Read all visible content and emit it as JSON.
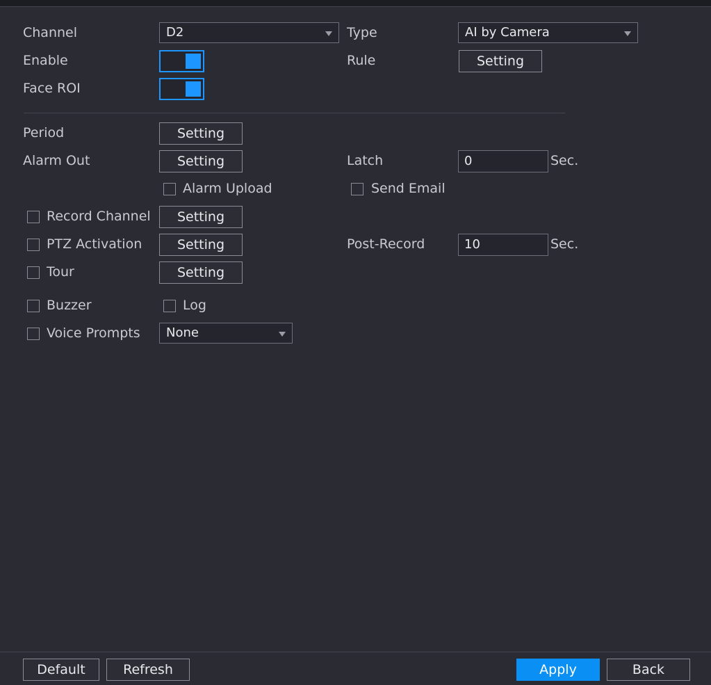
{
  "channel": {
    "label": "Channel",
    "value": "D2"
  },
  "type": {
    "label": "Type",
    "value": "AI by Camera"
  },
  "enable": {
    "label": "Enable",
    "on": true
  },
  "rule": {
    "label": "Rule",
    "button": "Setting"
  },
  "face_roi": {
    "label": "Face ROI",
    "on": true
  },
  "period": {
    "label": "Period",
    "button": "Setting"
  },
  "alarm_out": {
    "label": "Alarm Out",
    "button": "Setting"
  },
  "latch": {
    "label": "Latch",
    "value": "0",
    "unit": "Sec."
  },
  "alarm_upload": {
    "label": "Alarm Upload",
    "checked": false
  },
  "send_email": {
    "label": "Send Email",
    "checked": false
  },
  "record_channel": {
    "label": "Record Channel",
    "button": "Setting",
    "checked": false
  },
  "ptz_activation": {
    "label": "PTZ Activation",
    "button": "Setting",
    "checked": false
  },
  "post_record": {
    "label": "Post-Record",
    "value": "10",
    "unit": "Sec."
  },
  "tour": {
    "label": "Tour",
    "button": "Setting",
    "checked": false
  },
  "buzzer": {
    "label": "Buzzer",
    "checked": false
  },
  "log": {
    "label": "Log",
    "checked": false
  },
  "voice_prompts": {
    "label": "Voice Prompts",
    "value": "None",
    "checked": false
  },
  "footer": {
    "default": "Default",
    "refresh": "Refresh",
    "apply": "Apply",
    "back": "Back"
  },
  "colors": {
    "accent": "#1e96ff",
    "primary_button": "#0a8ff5",
    "background": "#2a2b33"
  }
}
